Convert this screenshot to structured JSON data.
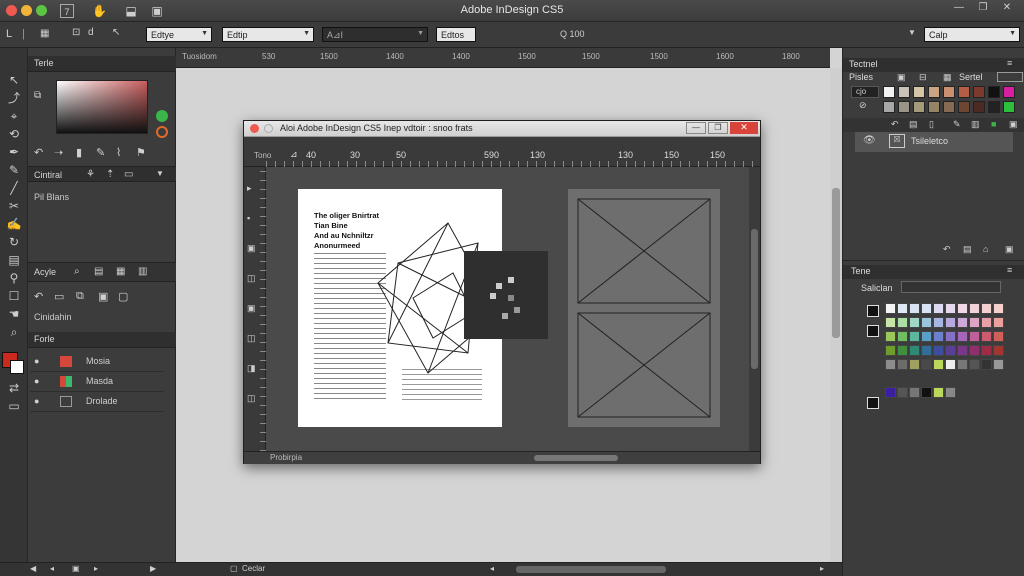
{
  "app": {
    "title": "Adobe InDesign CS5"
  },
  "control_bar": {
    "dropdown1": "Edtye",
    "dropdown2": "Edtip",
    "dropdown3": "A⊿I",
    "button1": "Edtos",
    "search_label": "Q 100",
    "right_dropdown": "Calp"
  },
  "top_ruler": {
    "ticks": [
      "Tuosidom",
      "530",
      "1500",
      "1400",
      "1400",
      "1500",
      "1500",
      "1500",
      "1600",
      "1800"
    ]
  },
  "left_panel": {
    "panel1_tab": "Terle",
    "panel1_section": "Cintiral",
    "panel1_text": "Pil Blans",
    "panel2_tab": "Acyle",
    "panel2_text": "Cinidahin",
    "layers_tab": "Forle",
    "layers": [
      {
        "label": "Mosia",
        "color": "#d6483c"
      },
      {
        "label": "Masda",
        "color": "#d6483c"
      },
      {
        "label": "Drolade",
        "color": "#777777"
      }
    ]
  },
  "doc_window": {
    "title": "Aloi  Adobe InDesign CS5  Inep vdtoir :  snoo  frats",
    "ruler_label": "Tono",
    "ruler_ticks": [
      "40",
      "30",
      "50",
      "590",
      "130",
      "130",
      "150",
      "150"
    ],
    "status_text": "Probirpia",
    "page_heading": [
      "The oliger Bnirtrat",
      "Tian Bine",
      "And au Nchniltzr",
      "Anonurmeed"
    ]
  },
  "bottom_bar": {
    "label": "Ceclar"
  },
  "right_panel_top": {
    "tab1": "Tectnel",
    "tab2": "Pisles",
    "tab3": "Sertel",
    "field": "cjo",
    "layer_label": "Tsileletco"
  },
  "right_panel_bottom": {
    "tab": "Tene",
    "label": "Saliclan"
  },
  "colors": {
    "accent_red": "#cc2a1f",
    "accent_green": "#39b54a"
  }
}
